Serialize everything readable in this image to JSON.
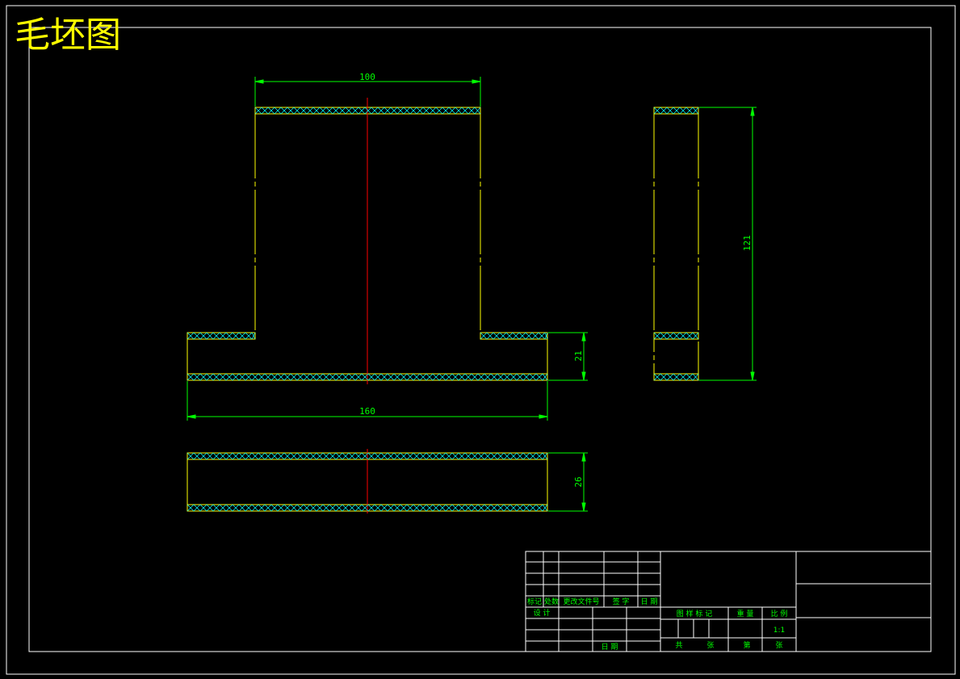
{
  "drawing_title": "毛坯图",
  "dimensions": {
    "top_width": "100",
    "base_width": "160",
    "base_height": "21",
    "side_height": "121",
    "bottom_height": "26"
  },
  "title_block": {
    "mark": "标记",
    "count": "处数",
    "change_doc": "更改文件号",
    "signature": "签 字",
    "date": "日 期",
    "design": "设 计",
    "review_date": "日 期",
    "stage_mark": "图 样 标 记",
    "weight": "重 量",
    "scale_label": "比 例",
    "scale_value": "1:1",
    "total": "共",
    "sheets": "张",
    "sheet_no": "第",
    "sheet_unit": "张"
  },
  "colors": {
    "background": "#000000",
    "outline": "#ffffff",
    "part": "#ffff00",
    "dimension": "#00ff00",
    "hatch": "#00ffff",
    "centerline": "#ff0000",
    "title": "#ffff00"
  }
}
